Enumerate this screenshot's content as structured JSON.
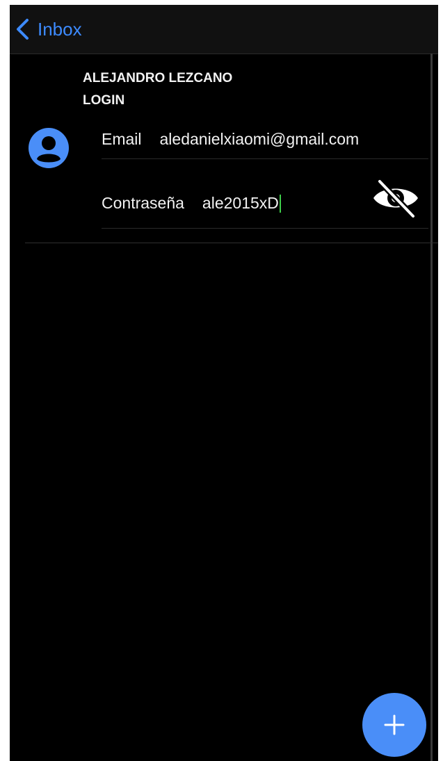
{
  "topbar": {
    "back_label": "Inbox",
    "back_icon": "chevron-left-icon"
  },
  "entry": {
    "owner": "ALEJANDRO LEZCANO",
    "title": "LOGIN",
    "avatar_icon": "person-circle-icon"
  },
  "fields": {
    "email_label": "Email",
    "email_value": "aledanielxiaomi@gmail.com",
    "password_label": "Contraseña",
    "password_value": "ale2015xD",
    "visibility_icon": "eye-slash-icon"
  },
  "fab": {
    "icon": "plus-icon"
  },
  "colors": {
    "accent": "#3d8bff",
    "fab": "#4a8ef8",
    "background": "#000000",
    "text": "#f2f2f2"
  }
}
